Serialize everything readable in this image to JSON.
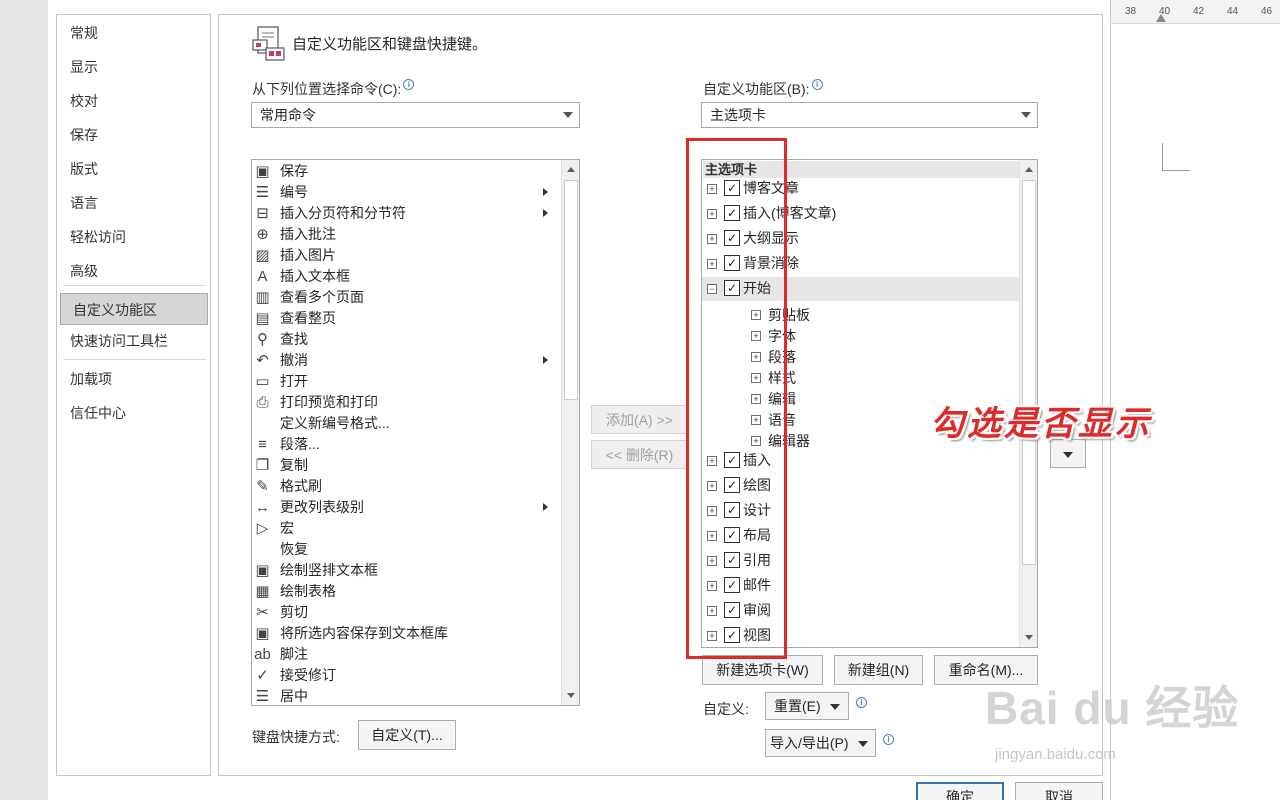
{
  "ruler": {
    "ticks": [
      "38",
      "40",
      "42",
      "44",
      "46"
    ]
  },
  "watermark": {
    "logo": "Bai du 经验",
    "url": "jingyan.baidu.com"
  },
  "nav": {
    "items": [
      "常规",
      "显示",
      "校对",
      "保存",
      "版式",
      "语言",
      "轻松访问",
      "高级",
      "自定义功能区",
      "快速访问工具栏",
      "加载项",
      "信任中心"
    ],
    "selected_index": 8
  },
  "header": {
    "title": "自定义功能区和键盘快捷键。"
  },
  "left_panel": {
    "label": "从下列位置选择命令(C):",
    "combo_value": "常用命令",
    "commands": [
      {
        "label": "保存",
        "icon": "save-icon",
        "glyph": "▣"
      },
      {
        "label": "编号",
        "icon": "numbering-icon",
        "glyph": "☰",
        "submenu": true
      },
      {
        "label": "插入分页符和分节符",
        "icon": "page-break-icon",
        "glyph": "⊟",
        "submenu": true
      },
      {
        "label": "插入批注",
        "icon": "comment-icon",
        "glyph": "⊕"
      },
      {
        "label": "插入图片",
        "icon": "picture-icon",
        "glyph": "▨"
      },
      {
        "label": "插入文本框",
        "icon": "textbox-icon",
        "glyph": "A"
      },
      {
        "label": "查看多个页面",
        "icon": "multi-page-icon",
        "glyph": "▥"
      },
      {
        "label": "查看整页",
        "icon": "full-page-icon",
        "glyph": "▤"
      },
      {
        "label": "查找",
        "icon": "find-icon",
        "glyph": "⚲"
      },
      {
        "label": "撤消",
        "icon": "undo-icon",
        "glyph": "↶",
        "submenu": true
      },
      {
        "label": "打开",
        "icon": "open-icon",
        "glyph": "▭"
      },
      {
        "label": "打印预览和打印",
        "icon": "print-preview-icon",
        "glyph": "⎙"
      },
      {
        "label": "定义新编号格式...",
        "icon": "",
        "glyph": ""
      },
      {
        "label": "段落...",
        "icon": "paragraph-icon",
        "glyph": "≡"
      },
      {
        "label": "复制",
        "icon": "copy-icon",
        "glyph": "❐"
      },
      {
        "label": "格式刷",
        "icon": "format-painter-icon",
        "glyph": "✎"
      },
      {
        "label": "更改列表级别",
        "icon": "list-level-icon",
        "glyph": "↔",
        "submenu": true
      },
      {
        "label": "宏",
        "icon": "macro-icon",
        "glyph": "▷"
      },
      {
        "label": "恢复",
        "icon": "",
        "glyph": ""
      },
      {
        "label": "绘制竖排文本框",
        "icon": "vertical-textbox-icon",
        "glyph": "▣"
      },
      {
        "label": "绘制表格",
        "icon": "draw-table-icon",
        "glyph": "▦"
      },
      {
        "label": "剪切",
        "icon": "cut-icon",
        "glyph": "✂"
      },
      {
        "label": "将所选内容保存到文本框库",
        "icon": "save-selection-icon",
        "glyph": "▣"
      },
      {
        "label": "脚注",
        "icon": "footnote-icon",
        "glyph": "ab"
      },
      {
        "label": "接受修订",
        "icon": "accept-change-icon",
        "glyph": "✓"
      },
      {
        "label": "居中",
        "icon": "center-icon",
        "glyph": "☰"
      }
    ]
  },
  "middle": {
    "add_label": "添加(A) >>",
    "remove_label": "<< 删除(R)"
  },
  "right_panel": {
    "label": "自定义功能区(B):",
    "combo_value": "主选项卡",
    "tree_header": "主选项卡",
    "tabs_before": [
      {
        "label": "博客文章",
        "checked": true
      },
      {
        "label": "插入(博客文章)",
        "checked": true
      },
      {
        "label": "大纲显示",
        "checked": true
      },
      {
        "label": "背景消除",
        "checked": true
      }
    ],
    "expanded_tab": {
      "label": "开始",
      "checked": true
    },
    "groups": [
      "剪贴板",
      "字体",
      "段落",
      "样式",
      "编辑",
      "语音",
      "编辑器"
    ],
    "tabs_after": [
      {
        "label": "插入",
        "checked": true
      },
      {
        "label": "绘图",
        "checked": true
      },
      {
        "label": "设计",
        "checked": true
      },
      {
        "label": "布局",
        "checked": true
      },
      {
        "label": "引用",
        "checked": true
      },
      {
        "label": "邮件",
        "checked": true
      },
      {
        "label": "审阅",
        "checked": true
      },
      {
        "label": "视图",
        "checked": true
      }
    ],
    "new_tab_label": "新建选项卡(W)",
    "new_group_label": "新建组(N)",
    "rename_label": "重命名(M)...",
    "customize_label": "自定义:",
    "reset_label": "重置(E)",
    "import_export_label": "导入/导出(P)"
  },
  "footer": {
    "keyboard_label": "键盘快捷方式:",
    "customize_button": "自定义(T)...",
    "ok_label": "确定",
    "cancel_label": "取消"
  },
  "annotation": {
    "text": "勾选是否显示",
    "color": "#e02a2a"
  },
  "colors": {
    "selected_nav": "#d6d6d6",
    "highlight_row": "#e6e6e6",
    "primary_border": "#3d6fb5"
  }
}
